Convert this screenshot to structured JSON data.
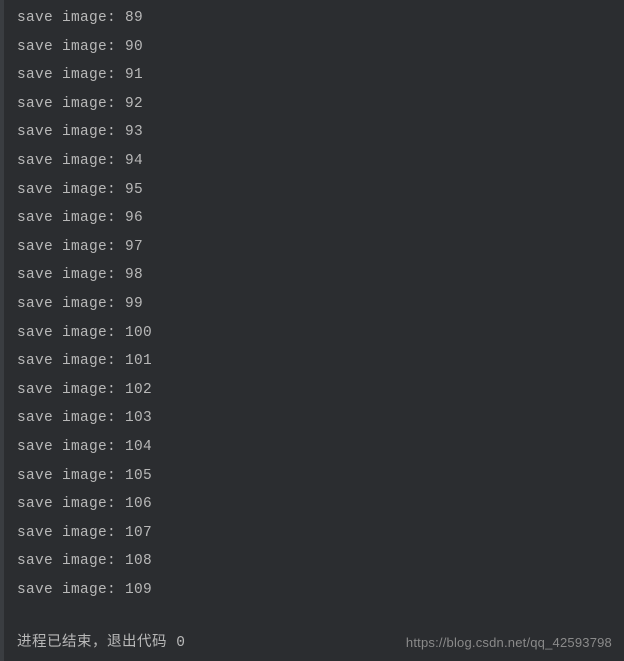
{
  "console": {
    "prefix": "save image: ",
    "lines": [
      "89",
      "90",
      "91",
      "92",
      "93",
      "94",
      "95",
      "96",
      "97",
      "98",
      "99",
      "100",
      "101",
      "102",
      "103",
      "104",
      "105",
      "106",
      "107",
      "108",
      "109"
    ]
  },
  "status": {
    "message": "进程已结束，退出代码 0"
  },
  "watermark": {
    "text": "https://blog.csdn.net/qq_42593798"
  }
}
